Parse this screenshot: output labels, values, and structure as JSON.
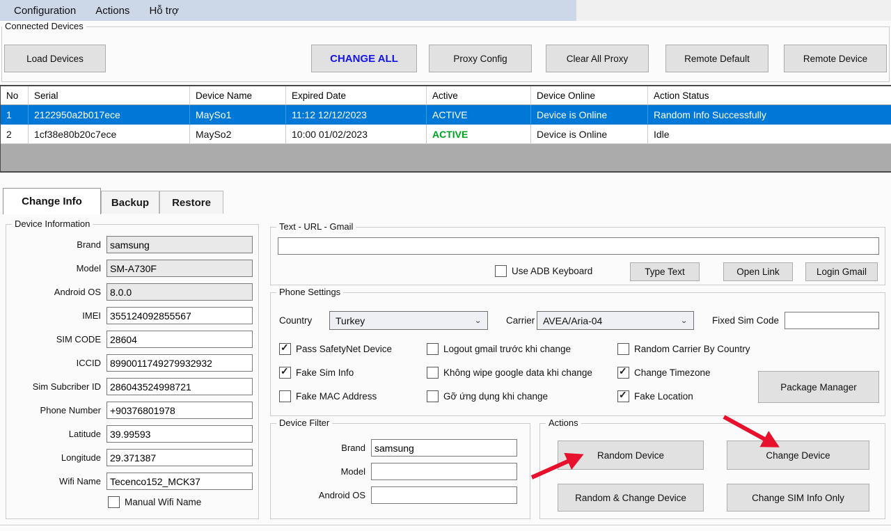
{
  "colors": {
    "menubar_bg": "#ccd7e8",
    "selected_row_blue": "#0078d7",
    "active_green": "#00a321",
    "change_all_blue": "#1414e6",
    "arrow_red": "#e8112d"
  },
  "menu": {
    "items": [
      "Configuration",
      "Actions",
      "Hỗ trợ"
    ]
  },
  "connected_devices": {
    "title": "Connected Devices",
    "load_devices": "Load Devices",
    "change_all": "CHANGE ALL",
    "proxy_config": "Proxy Config",
    "clear_all_proxy": "Clear All Proxy",
    "remote_default": "Remote Default",
    "remote_device": "Remote Device"
  },
  "device_grid": {
    "columns": [
      "No",
      "Serial",
      "Device Name",
      "Expired Date",
      "Active",
      "Device Online",
      "Action Status"
    ],
    "rows": [
      {
        "no": "1",
        "serial": "2122950a2b017ece",
        "device_name": "MaySo1",
        "expired_date": "11:12 12/12/2023",
        "active": "ACTIVE",
        "device_online": "Device is Online",
        "action_status": "Random Info Successfully",
        "selected": true
      },
      {
        "no": "2",
        "serial": "1cf38e80b20c7ece",
        "device_name": "MaySo2",
        "expired_date": "10:00 01/02/2023",
        "active": "ACTIVE",
        "device_online": "Device is Online",
        "action_status": "Idle",
        "selected": false
      }
    ]
  },
  "tabs": {
    "change_info": "Change Info",
    "backup": "Backup",
    "restore": "Restore"
  },
  "device_information": {
    "title": "Device Information",
    "fields": [
      {
        "label": "Brand",
        "value": "samsung",
        "readonly": true
      },
      {
        "label": "Model",
        "value": "SM-A730F",
        "readonly": true
      },
      {
        "label": "Android OS",
        "value": "8.0.0",
        "readonly": true
      },
      {
        "label": "IMEI",
        "value": "355124092855567",
        "readonly": false
      },
      {
        "label": "SIM CODE",
        "value": "28604",
        "readonly": false
      },
      {
        "label": "ICCID",
        "value": "8990011749279932932",
        "readonly": false
      },
      {
        "label": "Sim Subcriber ID",
        "value": "286043524998721",
        "readonly": false
      },
      {
        "label": "Phone Number",
        "value": "+90376801978",
        "readonly": false
      },
      {
        "label": "Latitude",
        "value": "39.99593",
        "readonly": false
      },
      {
        "label": "Longitude",
        "value": "29.371387",
        "readonly": false
      },
      {
        "label": "Wifi Name",
        "value": "Tecenco152_MCK37",
        "readonly": false
      }
    ],
    "manual_wifi": {
      "label": "Manual Wifi Name",
      "checked": false
    }
  },
  "text_url_gmail": {
    "title": "Text - URL - Gmail",
    "input_value": "",
    "use_adb_keyboard": {
      "label": "Use ADB Keyboard",
      "checked": false
    },
    "type_text": "Type Text",
    "open_link": "Open Link",
    "login_gmail": "Login Gmail"
  },
  "phone_settings": {
    "title": "Phone Settings",
    "country_label": "Country",
    "country_value": "Turkey",
    "carrier_label": "Carrier",
    "carrier_value": "AVEA/Aria-04",
    "fixed_sim_code_label": "Fixed Sim Code",
    "fixed_sim_code_value": "",
    "checkbox_cols": [
      [
        {
          "label": "Pass SafetyNet Device",
          "checked": true
        },
        {
          "label": "Fake Sim Info",
          "checked": true
        },
        {
          "label": "Fake MAC Address",
          "checked": false
        }
      ],
      [
        {
          "label": "Logout gmail trước khi change",
          "checked": false
        },
        {
          "label": "Không wipe google data khi change",
          "checked": false
        },
        {
          "label": "Gỡ ứng dụng khi change",
          "checked": false
        }
      ],
      [
        {
          "label": "Random Carrier By Country",
          "checked": false
        },
        {
          "label": "Change Timezone",
          "checked": true
        },
        {
          "label": "Fake Location",
          "checked": true
        }
      ]
    ],
    "package_manager": "Package Manager"
  },
  "device_filter": {
    "title": "Device Filter",
    "fields": [
      {
        "label": "Brand",
        "value": "samsung"
      },
      {
        "label": "Model",
        "value": ""
      },
      {
        "label": "Android OS",
        "value": ""
      }
    ]
  },
  "actions_group": {
    "title": "Actions",
    "random_device": "Random Device",
    "change_device": "Change Device",
    "random_change_device": "Random & Change Device",
    "change_sim_info_only": "Change SIM Info Only"
  }
}
